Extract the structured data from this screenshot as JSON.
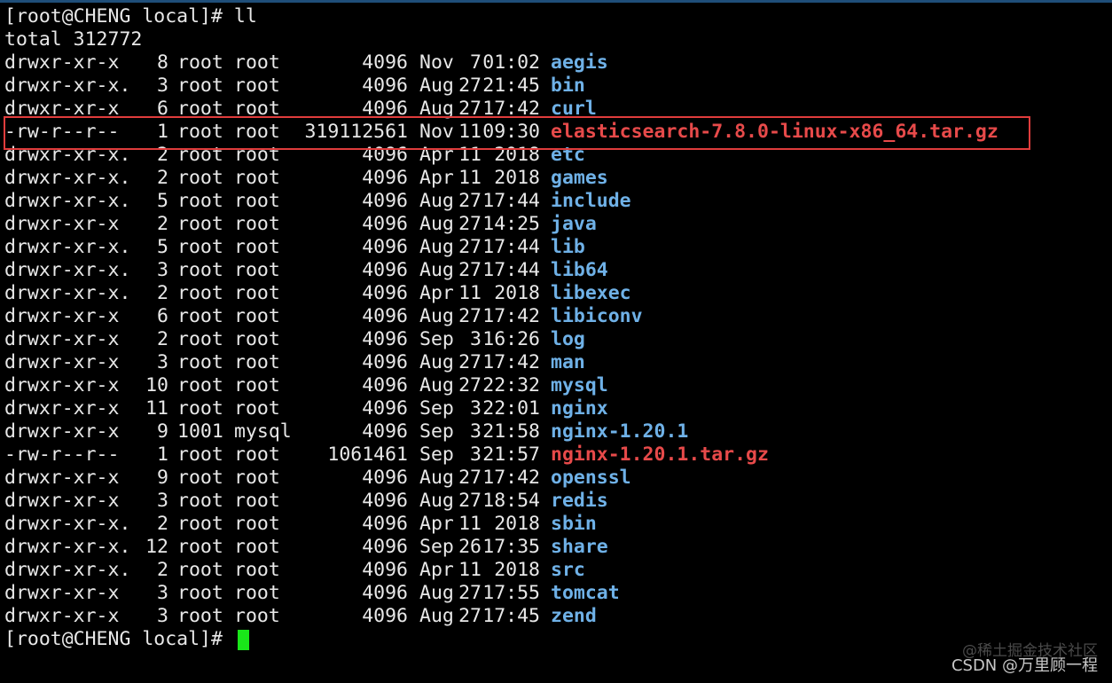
{
  "terminal": {
    "prompt": "[root@CHENG local]# ",
    "command": "ll",
    "total": "total 312772",
    "entries": [
      {
        "perm": "drwxr-xr-x",
        "links": "8",
        "owner": "root",
        "group": "root",
        "size": "4096",
        "month": "Nov",
        "day": "7",
        "time": "01:02",
        "name": "aegis",
        "kind": "dir"
      },
      {
        "perm": "drwxr-xr-x.",
        "links": "3",
        "owner": "root",
        "group": "root",
        "size": "4096",
        "month": "Aug",
        "day": "27",
        "time": "21:45",
        "name": "bin",
        "kind": "dir"
      },
      {
        "perm": "drwxr-xr-x",
        "links": "6",
        "owner": "root",
        "group": "root",
        "size": "4096",
        "month": "Aug",
        "day": "27",
        "time": "17:42",
        "name": "curl",
        "kind": "dir"
      },
      {
        "perm": "-rw-r--r--",
        "links": "1",
        "owner": "root",
        "group": "root",
        "size": "319112561",
        "month": "Nov",
        "day": "11",
        "time": "09:30",
        "name": "elasticsearch-7.8.0-linux-x86_64.tar.gz",
        "kind": "archive"
      },
      {
        "perm": "drwxr-xr-x.",
        "links": "2",
        "owner": "root",
        "group": "root",
        "size": "4096",
        "month": "Apr",
        "day": "11",
        "time": "2018",
        "name": "etc",
        "kind": "dir"
      },
      {
        "perm": "drwxr-xr-x.",
        "links": "2",
        "owner": "root",
        "group": "root",
        "size": "4096",
        "month": "Apr",
        "day": "11",
        "time": "2018",
        "name": "games",
        "kind": "dir"
      },
      {
        "perm": "drwxr-xr-x.",
        "links": "5",
        "owner": "root",
        "group": "root",
        "size": "4096",
        "month": "Aug",
        "day": "27",
        "time": "17:44",
        "name": "include",
        "kind": "dir"
      },
      {
        "perm": "drwxr-xr-x",
        "links": "2",
        "owner": "root",
        "group": "root",
        "size": "4096",
        "month": "Aug",
        "day": "27",
        "time": "14:25",
        "name": "java",
        "kind": "dir"
      },
      {
        "perm": "drwxr-xr-x.",
        "links": "5",
        "owner": "root",
        "group": "root",
        "size": "4096",
        "month": "Aug",
        "day": "27",
        "time": "17:44",
        "name": "lib",
        "kind": "dir"
      },
      {
        "perm": "drwxr-xr-x.",
        "links": "3",
        "owner": "root",
        "group": "root",
        "size": "4096",
        "month": "Aug",
        "day": "27",
        "time": "17:44",
        "name": "lib64",
        "kind": "dir"
      },
      {
        "perm": "drwxr-xr-x.",
        "links": "2",
        "owner": "root",
        "group": "root",
        "size": "4096",
        "month": "Apr",
        "day": "11",
        "time": "2018",
        "name": "libexec",
        "kind": "dir"
      },
      {
        "perm": "drwxr-xr-x",
        "links": "6",
        "owner": "root",
        "group": "root",
        "size": "4096",
        "month": "Aug",
        "day": "27",
        "time": "17:42",
        "name": "libiconv",
        "kind": "dir"
      },
      {
        "perm": "drwxr-xr-x",
        "links": "2",
        "owner": "root",
        "group": "root",
        "size": "4096",
        "month": "Sep",
        "day": "3",
        "time": "16:26",
        "name": "log",
        "kind": "dir"
      },
      {
        "perm": "drwxr-xr-x",
        "links": "3",
        "owner": "root",
        "group": "root",
        "size": "4096",
        "month": "Aug",
        "day": "27",
        "time": "17:42",
        "name": "man",
        "kind": "dir"
      },
      {
        "perm": "drwxr-xr-x",
        "links": "10",
        "owner": "root",
        "group": "root",
        "size": "4096",
        "month": "Aug",
        "day": "27",
        "time": "22:32",
        "name": "mysql",
        "kind": "dir"
      },
      {
        "perm": "drwxr-xr-x",
        "links": "11",
        "owner": "root",
        "group": "root",
        "size": "4096",
        "month": "Sep",
        "day": "3",
        "time": "22:01",
        "name": "nginx",
        "kind": "dir"
      },
      {
        "perm": "drwxr-xr-x",
        "links": "9",
        "owner": "1001",
        "group": "mysql",
        "size": "4096",
        "month": "Sep",
        "day": "3",
        "time": "21:58",
        "name": "nginx-1.20.1",
        "kind": "dir"
      },
      {
        "perm": "-rw-r--r--",
        "links": "1",
        "owner": "root",
        "group": "root",
        "size": "1061461",
        "month": "Sep",
        "day": "3",
        "time": "21:57",
        "name": "nginx-1.20.1.tar.gz",
        "kind": "archive"
      },
      {
        "perm": "drwxr-xr-x",
        "links": "9",
        "owner": "root",
        "group": "root",
        "size": "4096",
        "month": "Aug",
        "day": "27",
        "time": "17:42",
        "name": "openssl",
        "kind": "dir"
      },
      {
        "perm": "drwxr-xr-x",
        "links": "3",
        "owner": "root",
        "group": "root",
        "size": "4096",
        "month": "Aug",
        "day": "27",
        "time": "18:54",
        "name": "redis",
        "kind": "dir"
      },
      {
        "perm": "drwxr-xr-x.",
        "links": "2",
        "owner": "root",
        "group": "root",
        "size": "4096",
        "month": "Apr",
        "day": "11",
        "time": "2018",
        "name": "sbin",
        "kind": "dir"
      },
      {
        "perm": "drwxr-xr-x.",
        "links": "12",
        "owner": "root",
        "group": "root",
        "size": "4096",
        "month": "Sep",
        "day": "26",
        "time": "17:35",
        "name": "share",
        "kind": "dir"
      },
      {
        "perm": "drwxr-xr-x.",
        "links": "2",
        "owner": "root",
        "group": "root",
        "size": "4096",
        "month": "Apr",
        "day": "11",
        "time": "2018",
        "name": "src",
        "kind": "dir"
      },
      {
        "perm": "drwxr-xr-x",
        "links": "3",
        "owner": "root",
        "group": "root",
        "size": "4096",
        "month": "Aug",
        "day": "27",
        "time": "17:55",
        "name": "tomcat",
        "kind": "dir"
      },
      {
        "perm": "drwxr-xr-x",
        "links": "3",
        "owner": "root",
        "group": "root",
        "size": "4096",
        "month": "Aug",
        "day": "27",
        "time": "17:45",
        "name": "zend",
        "kind": "dir"
      }
    ],
    "highlighted_entry": "elasticsearch-7.8.0-linux-x86_64.tar.gz"
  },
  "colors": {
    "background": "#000000",
    "text": "#e8e8e8",
    "directory": "#6fb1e7",
    "archive": "#e74a4a",
    "cursor": "#19e619",
    "highlight_box": "#e03c3c"
  },
  "watermark": {
    "line1": "@稀土掘金技术社区",
    "line2": "CSDN @万里顾一程"
  }
}
